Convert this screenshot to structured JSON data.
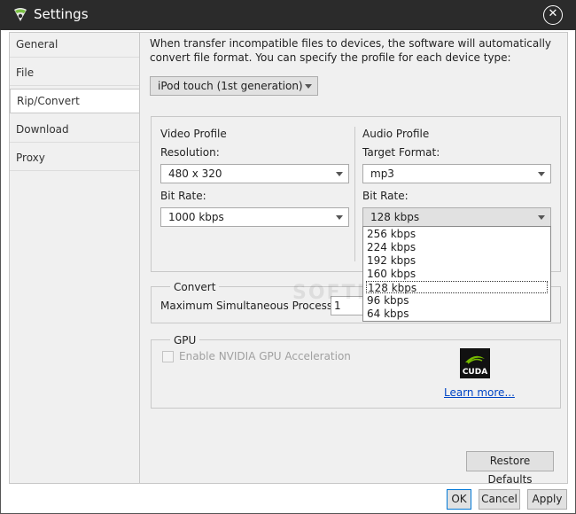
{
  "window": {
    "title": "Settings",
    "app_icon": "app-logo-icon",
    "close_icon": "close-icon",
    "close_glyph": "✕"
  },
  "sidebar": {
    "items": [
      {
        "label": "General"
      },
      {
        "label": "File"
      },
      {
        "label": "Rip/Convert"
      },
      {
        "label": "Download"
      },
      {
        "label": "Proxy"
      }
    ],
    "selected": "Rip/Convert"
  },
  "description": "When transfer incompatible files to devices, the software will automatically convert file format. You can specify the profile for each device type:",
  "device_select": {
    "value": "iPod touch (1st generation)"
  },
  "video_profile": {
    "title": "Video Profile",
    "resolution_label": "Resolution:",
    "resolution_value": "480 x 320",
    "bitrate_label": "Bit Rate:",
    "bitrate_value": "1000 kbps"
  },
  "audio_profile": {
    "title": "Audio Profile",
    "format_label": "Target Format:",
    "format_value": "mp3",
    "bitrate_label": "Bit Rate:",
    "bitrate_value": "128 kbps",
    "bitrate_options": [
      "256 kbps",
      "224 kbps",
      "192 kbps",
      "160 kbps",
      "128 kbps",
      "96 kbps",
      "64 kbps"
    ],
    "bitrate_selected_index": 4
  },
  "convert": {
    "title": "Convert",
    "max_processes_label": "Maximum Simultaneous Processes:",
    "max_processes_value": "1"
  },
  "gpu": {
    "title": "GPU",
    "checkbox_label": "Enable NVIDIA GPU Acceleration",
    "checked": false,
    "logo_text": "CUDA",
    "learn_more": "Learn more..."
  },
  "buttons": {
    "restore_defaults": "Restore Defaults",
    "ok": "OK",
    "cancel": "Cancel",
    "apply": "Apply"
  },
  "watermark": "SOFTPEDIA",
  "colors": {
    "titlebar": "#2b2b2b",
    "accent": "#0078d7",
    "link": "#0045c5",
    "panel_bg": "#f0f0f0",
    "nvidia_green": "#76b900"
  }
}
